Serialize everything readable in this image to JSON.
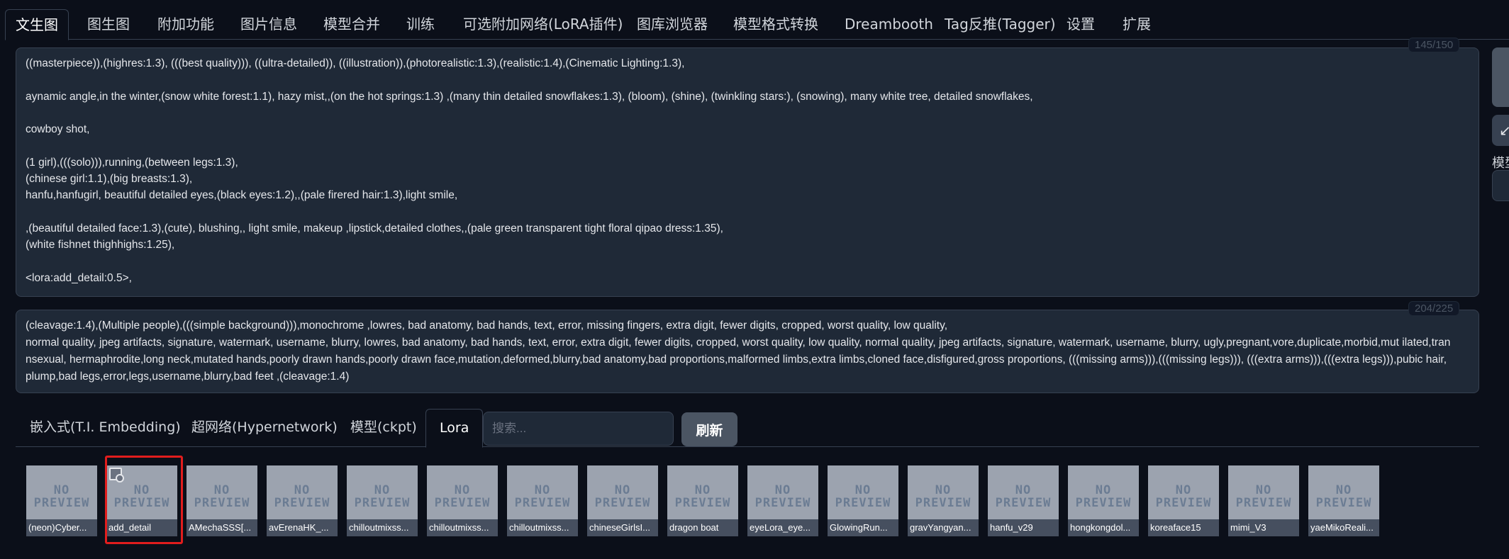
{
  "top_tabs": [
    "文生图",
    "图生图",
    "附加功能",
    "图片信息",
    "模型合并",
    "训练",
    "可选附加网络(LoRA插件)",
    "图库浏览器",
    "模型格式转换",
    "Dreambooth",
    "Tag反推(Tagger)",
    "设置",
    "扩展"
  ],
  "prompt": {
    "counter": "145/150",
    "lines": [
      "((masterpiece)),(highres:1.3), (((best quality))), ((ultra-detailed)), ((illustration)),(photorealistic:1.3),(realistic:1.4),(Cinematic Lighting:1.3),",
      "aynamic angle,in the winter,(snow white forest:1.1), hazy mist,,(on the hot springs:1.3) ,(many thin detailed snowflakes:1.3), (bloom), (shine), (twinkling stars:), (snowing), many white tree, detailed snowflakes,",
      "cowboy shot,",
      "(1 girl),(((solo))),running,(between legs:1.3),",
      "(chinese girl:1.1),(big breasts:1.3),",
      "hanfu,hanfugirl, beautiful detailed eyes,(black eyes:1.2),,(pale firered hair:1.3),light smile,",
      ",(beautiful detailed face:1.3),(cute), blushing,, light smile, makeup ,lipstick,detailed clothes,,(pale green transparent tight floral qipao dress:1.35),",
      "(white  fishnet thighhighs:1.25),",
      "<lora:add_detail:0.5>,"
    ]
  },
  "negative_prompt": {
    "counter": "204/225",
    "text": "(cleavage:1.4),(Multiple people),(((simple background))),monochrome ,lowres, bad anatomy, bad hands, text, error, missing fingers, extra digit, fewer digits, cropped, worst quality, low quality,\nnormal quality, jpeg artifacts, signature, watermark, username, blurry, lowres, bad anatomy, bad hands, text, error, extra digit, fewer digits, cropped, worst quality, low quality, normal quality, jpeg artifacts, signature, watermark, username, blurry, ugly,pregnant,vore,duplicate,morbid,mut ilated,tran nsexual, hermaphrodite,long neck,mutated hands,poorly drawn hands,poorly drawn face,mutation,deformed,blurry,bad anatomy,bad proportions,malformed limbs,extra limbs,cloned face,disfigured,gross proportions, (((missing arms))),(((missing legs))), (((extra arms))),(((extra legs))),pubic hair, plump,bad legs,error,legs,username,blurry,bad feet ,(cleavage:1.4)"
  },
  "right_panel": {
    "button_icon": "↙",
    "label": "模型"
  },
  "extra_networks": {
    "tabs": [
      "嵌入式(T.I. Embedding)",
      "超网络(Hypernetwork)",
      "模型(ckpt)",
      "Lora"
    ],
    "search_placeholder": "搜索...",
    "refresh_label": "刷新",
    "no_preview_line1": "NO",
    "no_preview_line2": "PREVIEW",
    "cards": [
      "(neon)Cyber...",
      "add_detail",
      "AMechaSSS[...",
      "avErenaHK_...",
      "chilloutmixss...",
      "chilloutmixss...",
      "chilloutmixss...",
      "chineseGirlsI...",
      "dragon boat",
      "eyeLora_eye...",
      "GlowingRun...",
      "gravYangyan...",
      "hanfu_v29",
      "hongkongdol...",
      "koreaface15",
      "mimi_V3",
      "yaeMikoReali..."
    ]
  }
}
